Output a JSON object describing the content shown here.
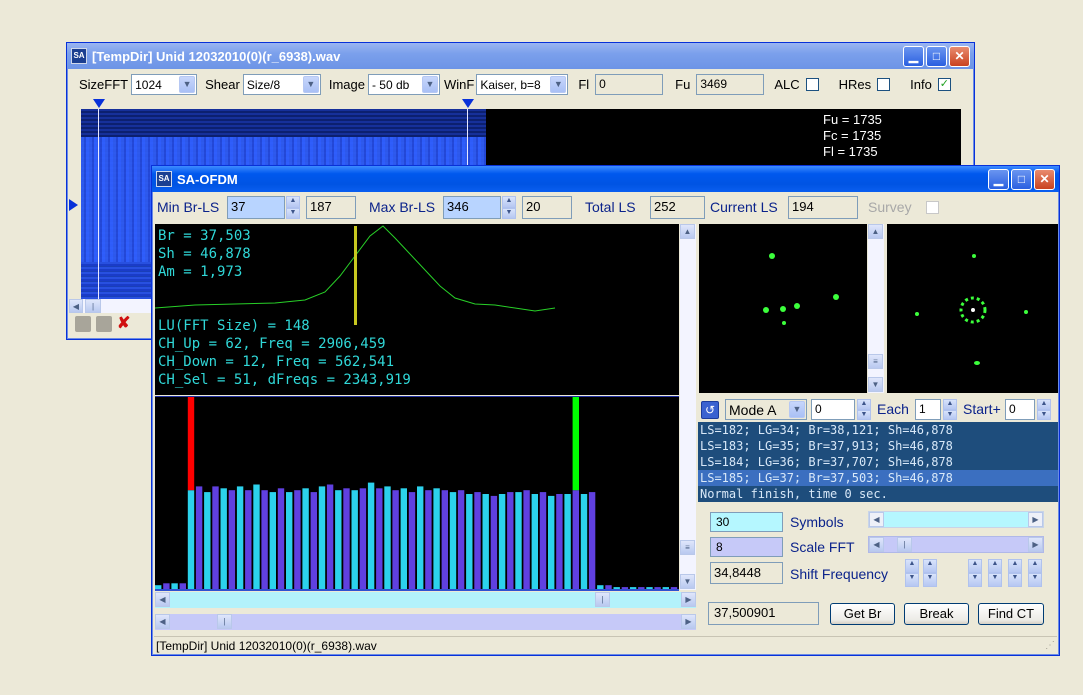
{
  "back": {
    "title": "[TempDir] Unid 12032010(0)(r_6938).wav",
    "sizefft_label": "SizeFFT",
    "sizefft_value": "1024",
    "shear_label": "Shear",
    "shear_value": "Size/8",
    "image_label": "Image",
    "image_value": "- 50 db",
    "winf_label": "WinF",
    "winf_value": "Kaiser, b=8",
    "fl_label": "Fl",
    "fl_value": "0",
    "fu_label": "Fu",
    "fu_value": "3469",
    "alc_label": "ALC",
    "hres_label": "HRes",
    "info_label": "Info",
    "info_lines": [
      "Fu = 1735",
      "Fc = 1735",
      "Fl = 1735"
    ]
  },
  "front": {
    "title": "SA-OFDM",
    "min_br_label": "Min Br-LS",
    "min_br_value": "37",
    "min_br_field": "187",
    "max_br_label": "Max Br-LS",
    "max_br_value": "346",
    "max_br_field": "20",
    "total_ls_label": "Total LS",
    "total_ls_value": "252",
    "current_ls_label": "Current LS",
    "current_ls_value": "194",
    "survey_label": "Survey",
    "stats_top": [
      "Br = 37,503",
      "Sh = 46,878",
      "Am = 1,973"
    ],
    "stats_bottom": [
      "LU(FFT Size) = 148",
      "CH_Up = 62, Freq = 2906,459",
      "CH_Down = 12, Freq = 562,541",
      "CH_Sel = 51, dFreqs = 2343,919"
    ],
    "mode_value": "Mode A",
    "mode_num": "0",
    "each_label": "Each",
    "each_value": "1",
    "start_label": "Start+",
    "start_value": "0",
    "log_lines": [
      "LS=182; LG=34; Br=38,121; Sh=46,878",
      "LS=183; LG=35; Br=37,913; Sh=46,878",
      "LS=184; LG=36; Br=37,707; Sh=46,878",
      "LS=185; LG=37; Br=37,503; Sh=46,878",
      "Normal finish, time 0 sec."
    ],
    "symbols_value": "30",
    "symbols_label": "Symbols",
    "scale_value": "8",
    "scale_label": "Scale FFT",
    "shift_value": "34,8448",
    "shift_label": "Shift Frequency",
    "result_value": "37,500901",
    "getbr_label": "Get Br",
    "break_label": "Break",
    "findct_label": "Find CT",
    "status_text": "[TempDir] Unid 12032010(0)(r_6938).wav"
  },
  "colors": {
    "accent": "#0054e3",
    "cyan": "#2cd2ec",
    "purple": "#6040e0",
    "green_trace": "#28d028",
    "stats_text": "#30d8d8"
  },
  "chart_data": {
    "type": "bar",
    "values": [
      2,
      3,
      3,
      3,
      52,
      54,
      51,
      54,
      53,
      52,
      54,
      52,
      55,
      52,
      51,
      53,
      51,
      52,
      53,
      51,
      54,
      55,
      52,
      53,
      52,
      53,
      56,
      53,
      54,
      52,
      53,
      51,
      54,
      52,
      53,
      52,
      51,
      52,
      50,
      51,
      50,
      49,
      50,
      51,
      51,
      52,
      50,
      51,
      49,
      50,
      50,
      52,
      50,
      51,
      2,
      2,
      1,
      1,
      1,
      1,
      1,
      1,
      1,
      1
    ],
    "markers": [
      {
        "index": 4,
        "color": "#ff0000"
      },
      {
        "index": 51,
        "color": "#00ff00"
      }
    ]
  }
}
